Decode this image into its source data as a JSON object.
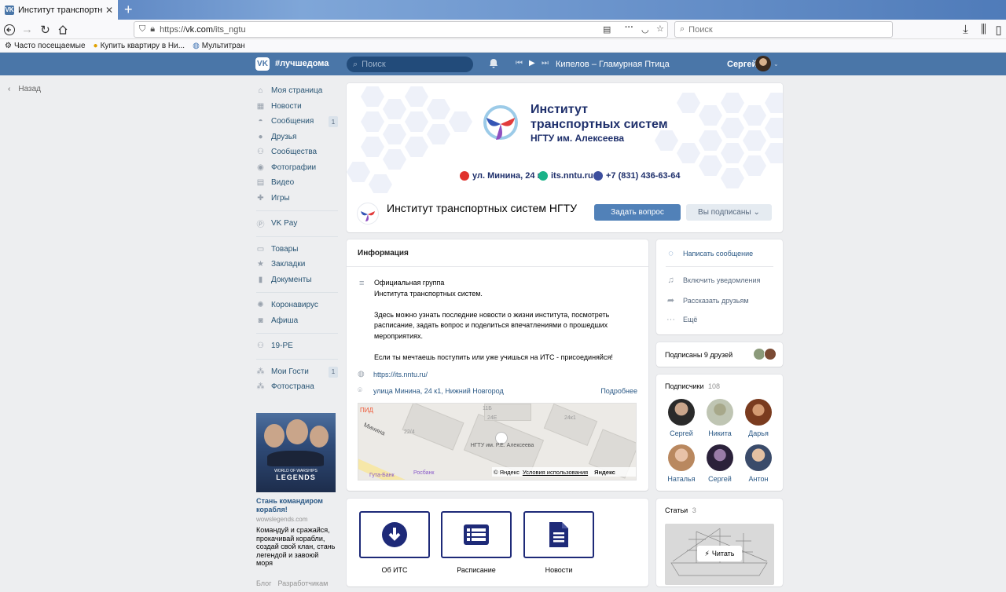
{
  "browser": {
    "tab_title": "Институт транспортных систем",
    "tab_close": "✕",
    "new_tab": "+",
    "url_scheme": "https://",
    "url_host": "vk.com",
    "url_path": "/its_ngtu",
    "search_placeholder": "Поиск",
    "bookmarks": [
      "Часто посещаемые",
      "Купить квартиру в Ни...",
      "Мультитран"
    ]
  },
  "vk_header": {
    "logo": "VK",
    "hashtag": "#лучшедома",
    "search_placeholder": "Поиск",
    "track": "Кипелов – Гламурная Птица",
    "user_name": "Сергей"
  },
  "nav": {
    "back": "Назад",
    "items": [
      {
        "label": "Моя страница",
        "icon": "home-icon"
      },
      {
        "label": "Новости",
        "icon": "news-icon"
      },
      {
        "label": "Сообщения",
        "icon": "messages-icon",
        "badge": "1"
      },
      {
        "label": "Друзья",
        "icon": "friends-icon"
      },
      {
        "label": "Сообщества",
        "icon": "communities-icon"
      },
      {
        "label": "Фотографии",
        "icon": "camera-icon"
      },
      {
        "label": "Видео",
        "icon": "video-icon"
      },
      {
        "label": "Игры",
        "icon": "games-icon"
      },
      {
        "label": "VK Pay",
        "icon": "vkpay-icon"
      },
      {
        "label": "Товары",
        "icon": "goods-icon"
      },
      {
        "label": "Закладки",
        "icon": "star-icon"
      },
      {
        "label": "Документы",
        "icon": "document-icon"
      },
      {
        "label": "Коронавирус",
        "icon": "virus-icon"
      },
      {
        "label": "Афиша",
        "icon": "poster-icon"
      },
      {
        "label": "19-РЕ",
        "icon": "group-icon"
      },
      {
        "label": "Мои Гости",
        "icon": "apps-icon",
        "badge": "1"
      },
      {
        "label": "Фотострана",
        "icon": "apps-icon"
      }
    ]
  },
  "ad": {
    "image_caption": "LEGENDS",
    "image_subcaption": "WORLD OF WARSHIPS",
    "title": "Стань командиром корабля!",
    "domain": "wowslegends.com",
    "text": "Командуй и сражайся, прокачивай корабли, создай свой клан, стань легендой и завоюй моря"
  },
  "footer": {
    "links": [
      "Блог",
      "Разработчикам"
    ]
  },
  "cover": {
    "title_line1": "Институт",
    "title_line2": "транспортных систем",
    "title_line3": "НГТУ им. Алексеева",
    "address": "ул. Минина, 24 к1",
    "site": "its.nntu.ru",
    "phone": "+7 (831) 436-63-64"
  },
  "group": {
    "name": "Институт транспортных систем НГТУ",
    "ask_button": "Задать вопрос",
    "subscribed_button": "Вы подписаны"
  },
  "info": {
    "heading": "Информация",
    "description": [
      "Официальная группа",
      "Института транспортных систем.",
      "",
      "Здесь можно узнать последние новости о жизни института, посмотреть расписание, задать вопрос и поделиться впечатлениями о прошедших мероприятиях.",
      "",
      "Если ты мечтаешь поступить или уже учишься на ИТС - присоединяйся!"
    ],
    "link": "https://its.nntu.ru/",
    "address": "улица Минина, 24 к1, Нижний Новгород",
    "more": "Подробнее",
    "map_labels": {
      "street": "Минина",
      "b1": "11Б",
      "b2": "24Е",
      "b3": "22/4",
      "b4": "24к1",
      "poi": "НГТУ им. Р.Е. Алексеева",
      "bank1": "Гута-Банк",
      "bank2": "Росбанк",
      "pid": "ПИД",
      "copyright": "© Яндекс",
      "terms": "Условия использования",
      "brand": "Яндекс"
    }
  },
  "actions": [
    {
      "label": "Об ИТС",
      "icon": "download-icon"
    },
    {
      "label": "Расписание",
      "icon": "list-icon"
    },
    {
      "label": "Новости",
      "icon": "document-icon"
    }
  ],
  "right": {
    "write_message": "Написать сообщение",
    "notify": "Включить уведомления",
    "tell_friends": "Рассказать друзьям",
    "more": "Ещё",
    "friends_subscribed": "Подписаны 9 друзей",
    "subscribers_label": "Подписчики",
    "subscribers_count": "108",
    "members": [
      "Сергей",
      "Никита",
      "Дарья",
      "Наталья",
      "Сергей",
      "Антон"
    ],
    "articles_label": "Статьи",
    "articles_count": "3",
    "read_button": "Читать"
  }
}
